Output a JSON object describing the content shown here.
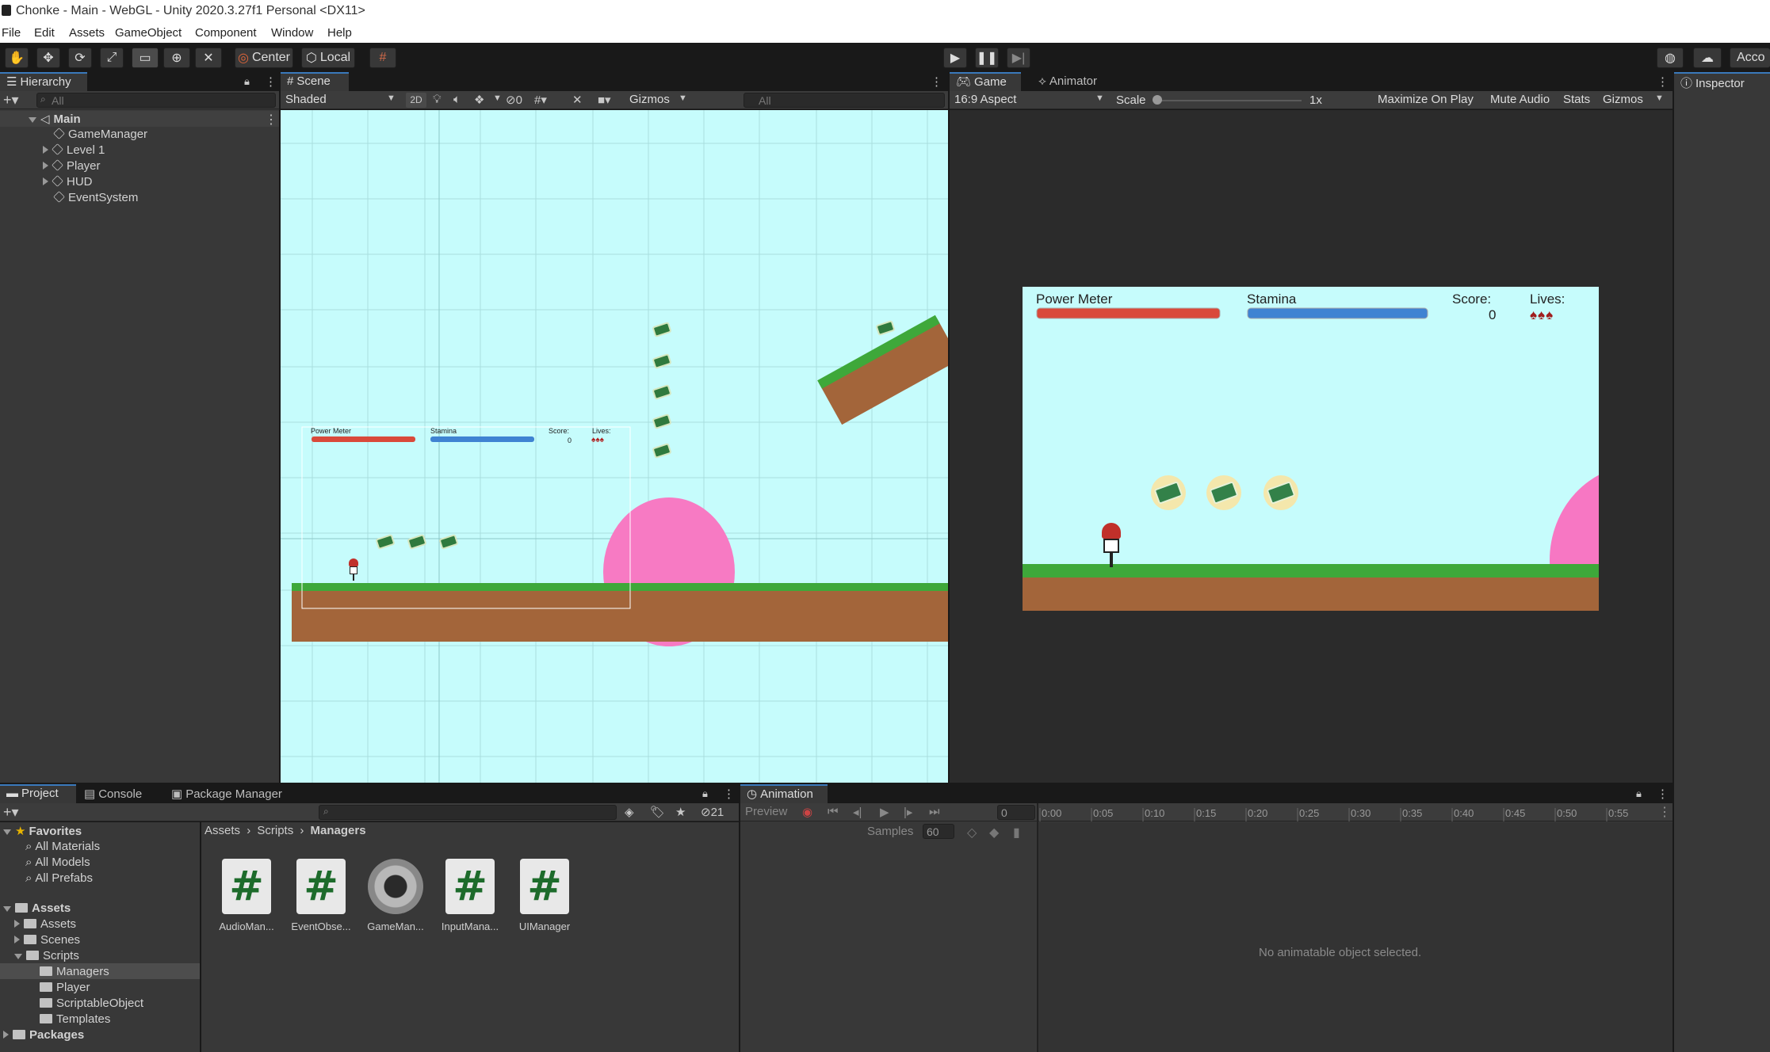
{
  "window": {
    "title": "Chonke - Main - WebGL - Unity 2020.3.27f1 Personal <DX11>"
  },
  "menu": [
    "File",
    "Edit",
    "Assets",
    "GameObject",
    "Component",
    "Window",
    "Help"
  ],
  "toolbar": {
    "center": "Center",
    "local": "Local",
    "account": "Acco"
  },
  "hierarchy": {
    "tab": "Hierarchy",
    "search": "All",
    "root": "Main",
    "items": [
      "GameManager",
      "Level 1",
      "Player",
      "HUD",
      "EventSystem"
    ]
  },
  "scene": {
    "tab": "Scene",
    "shading": "Shaded",
    "mode2d": "2D",
    "hidden_count": "0",
    "gizmos": "Gizmos",
    "search": "All",
    "hud": {
      "power": "Power Meter",
      "stamina": "Stamina",
      "score_label": "Score:",
      "score": "0",
      "lives": "Lives:"
    }
  },
  "game": {
    "tab": "Game",
    "animator_tab": "Animator",
    "aspect": "16:9 Aspect",
    "scale_label": "Scale",
    "scale_value": "1x",
    "buttons": [
      "Maximize On Play",
      "Mute Audio",
      "Stats",
      "Gizmos"
    ],
    "hud": {
      "power": "Power Meter",
      "stamina": "Stamina",
      "score_label": "Score:",
      "score": "0",
      "lives": "Lives:"
    }
  },
  "inspector": {
    "tab": "Inspector"
  },
  "project": {
    "tabs": [
      "Project",
      "Console",
      "Package Manager"
    ],
    "count": "21",
    "favorites": {
      "label": "Favorites",
      "items": [
        "All Materials",
        "All Models",
        "All Prefabs"
      ]
    },
    "assets": {
      "label": "Assets",
      "items": [
        "Assets",
        "Scenes",
        "Scripts"
      ]
    },
    "scripts": [
      "Managers",
      "Player",
      "ScriptableObject",
      "Templates"
    ],
    "packages": "Packages",
    "breadcrumb": [
      "Assets",
      "Scripts",
      "Managers"
    ],
    "files": [
      "AudioMan...",
      "EventObse...",
      "GameMan...",
      "InputMana...",
      "UIManager"
    ]
  },
  "animation": {
    "tab": "Animation",
    "preview": "Preview",
    "frame": "0",
    "samples_label": "Samples",
    "samples": "60",
    "ticks": [
      "0:00",
      "0:05",
      "0:10",
      "0:15",
      "0:20",
      "0:25",
      "0:30",
      "0:35",
      "0:40",
      "0:45",
      "0:50",
      "0:55"
    ],
    "empty": "No animatable object selected."
  },
  "colors": {
    "accent": "#3a79bb",
    "sky": "#c4fbfb",
    "grass": "#3ea83a",
    "dirt": "#a2653a",
    "pink": "#f777c3",
    "power": "#d9493a",
    "stamina": "#3f83d2"
  }
}
